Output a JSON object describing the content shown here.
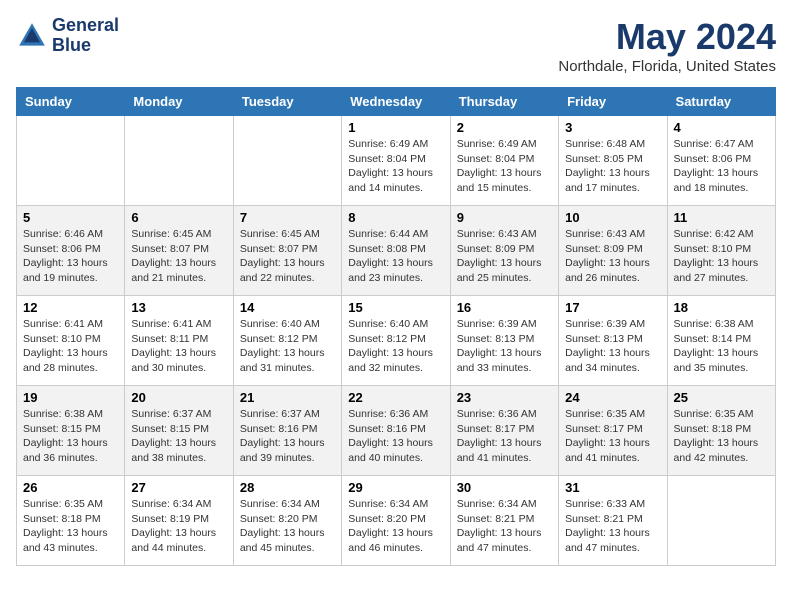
{
  "header": {
    "logo_line1": "General",
    "logo_line2": "Blue",
    "month": "May 2024",
    "location": "Northdale, Florida, United States"
  },
  "days_of_week": [
    "Sunday",
    "Monday",
    "Tuesday",
    "Wednesday",
    "Thursday",
    "Friday",
    "Saturday"
  ],
  "weeks": [
    [
      {
        "day": "",
        "info": ""
      },
      {
        "day": "",
        "info": ""
      },
      {
        "day": "",
        "info": ""
      },
      {
        "day": "1",
        "info": "Sunrise: 6:49 AM\nSunset: 8:04 PM\nDaylight: 13 hours and 14 minutes."
      },
      {
        "day": "2",
        "info": "Sunrise: 6:49 AM\nSunset: 8:04 PM\nDaylight: 13 hours and 15 minutes."
      },
      {
        "day": "3",
        "info": "Sunrise: 6:48 AM\nSunset: 8:05 PM\nDaylight: 13 hours and 17 minutes."
      },
      {
        "day": "4",
        "info": "Sunrise: 6:47 AM\nSunset: 8:06 PM\nDaylight: 13 hours and 18 minutes."
      }
    ],
    [
      {
        "day": "5",
        "info": "Sunrise: 6:46 AM\nSunset: 8:06 PM\nDaylight: 13 hours and 19 minutes."
      },
      {
        "day": "6",
        "info": "Sunrise: 6:45 AM\nSunset: 8:07 PM\nDaylight: 13 hours and 21 minutes."
      },
      {
        "day": "7",
        "info": "Sunrise: 6:45 AM\nSunset: 8:07 PM\nDaylight: 13 hours and 22 minutes."
      },
      {
        "day": "8",
        "info": "Sunrise: 6:44 AM\nSunset: 8:08 PM\nDaylight: 13 hours and 23 minutes."
      },
      {
        "day": "9",
        "info": "Sunrise: 6:43 AM\nSunset: 8:09 PM\nDaylight: 13 hours and 25 minutes."
      },
      {
        "day": "10",
        "info": "Sunrise: 6:43 AM\nSunset: 8:09 PM\nDaylight: 13 hours and 26 minutes."
      },
      {
        "day": "11",
        "info": "Sunrise: 6:42 AM\nSunset: 8:10 PM\nDaylight: 13 hours and 27 minutes."
      }
    ],
    [
      {
        "day": "12",
        "info": "Sunrise: 6:41 AM\nSunset: 8:10 PM\nDaylight: 13 hours and 28 minutes."
      },
      {
        "day": "13",
        "info": "Sunrise: 6:41 AM\nSunset: 8:11 PM\nDaylight: 13 hours and 30 minutes."
      },
      {
        "day": "14",
        "info": "Sunrise: 6:40 AM\nSunset: 8:12 PM\nDaylight: 13 hours and 31 minutes."
      },
      {
        "day": "15",
        "info": "Sunrise: 6:40 AM\nSunset: 8:12 PM\nDaylight: 13 hours and 32 minutes."
      },
      {
        "day": "16",
        "info": "Sunrise: 6:39 AM\nSunset: 8:13 PM\nDaylight: 13 hours and 33 minutes."
      },
      {
        "day": "17",
        "info": "Sunrise: 6:39 AM\nSunset: 8:13 PM\nDaylight: 13 hours and 34 minutes."
      },
      {
        "day": "18",
        "info": "Sunrise: 6:38 AM\nSunset: 8:14 PM\nDaylight: 13 hours and 35 minutes."
      }
    ],
    [
      {
        "day": "19",
        "info": "Sunrise: 6:38 AM\nSunset: 8:15 PM\nDaylight: 13 hours and 36 minutes."
      },
      {
        "day": "20",
        "info": "Sunrise: 6:37 AM\nSunset: 8:15 PM\nDaylight: 13 hours and 38 minutes."
      },
      {
        "day": "21",
        "info": "Sunrise: 6:37 AM\nSunset: 8:16 PM\nDaylight: 13 hours and 39 minutes."
      },
      {
        "day": "22",
        "info": "Sunrise: 6:36 AM\nSunset: 8:16 PM\nDaylight: 13 hours and 40 minutes."
      },
      {
        "day": "23",
        "info": "Sunrise: 6:36 AM\nSunset: 8:17 PM\nDaylight: 13 hours and 41 minutes."
      },
      {
        "day": "24",
        "info": "Sunrise: 6:35 AM\nSunset: 8:17 PM\nDaylight: 13 hours and 41 minutes."
      },
      {
        "day": "25",
        "info": "Sunrise: 6:35 AM\nSunset: 8:18 PM\nDaylight: 13 hours and 42 minutes."
      }
    ],
    [
      {
        "day": "26",
        "info": "Sunrise: 6:35 AM\nSunset: 8:18 PM\nDaylight: 13 hours and 43 minutes."
      },
      {
        "day": "27",
        "info": "Sunrise: 6:34 AM\nSunset: 8:19 PM\nDaylight: 13 hours and 44 minutes."
      },
      {
        "day": "28",
        "info": "Sunrise: 6:34 AM\nSunset: 8:20 PM\nDaylight: 13 hours and 45 minutes."
      },
      {
        "day": "29",
        "info": "Sunrise: 6:34 AM\nSunset: 8:20 PM\nDaylight: 13 hours and 46 minutes."
      },
      {
        "day": "30",
        "info": "Sunrise: 6:34 AM\nSunset: 8:21 PM\nDaylight: 13 hours and 47 minutes."
      },
      {
        "day": "31",
        "info": "Sunrise: 6:33 AM\nSunset: 8:21 PM\nDaylight: 13 hours and 47 minutes."
      },
      {
        "day": "",
        "info": ""
      }
    ]
  ]
}
